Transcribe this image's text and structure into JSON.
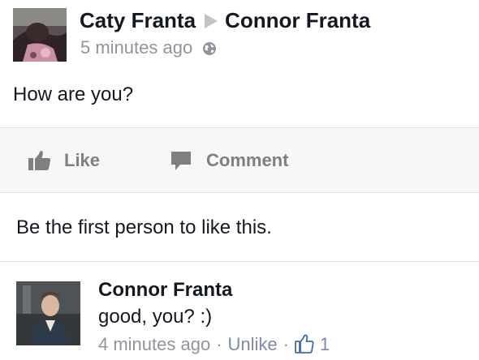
{
  "post": {
    "author": "Caty Franta",
    "target": "Connor Franta",
    "time": "5 minutes ago",
    "privacy_icon": "globe-icon",
    "text": "How are you?"
  },
  "actions": {
    "like_label": "Like",
    "like_icon": "thumbs-up-icon",
    "comment_label": "Comment",
    "comment_icon": "speech-bubble-icon"
  },
  "likes_summary": "Be the first person to like this.",
  "comment": {
    "author": "Connor Franta",
    "text": "good, you? :)",
    "time": "4 minutes ago",
    "separator": "·",
    "unlike_label": "Unlike",
    "like_count": "1",
    "like_icon": "blue-thumbs-up-icon"
  },
  "colors": {
    "text_primary": "#141823",
    "text_meta": "#90949c",
    "action_gray": "#7f7f7f",
    "link_blue": "#7b8aa9",
    "action_bar_bg": "#f6f7f9",
    "divider": "#e1e2e3",
    "like_blue": "#4267b2"
  }
}
